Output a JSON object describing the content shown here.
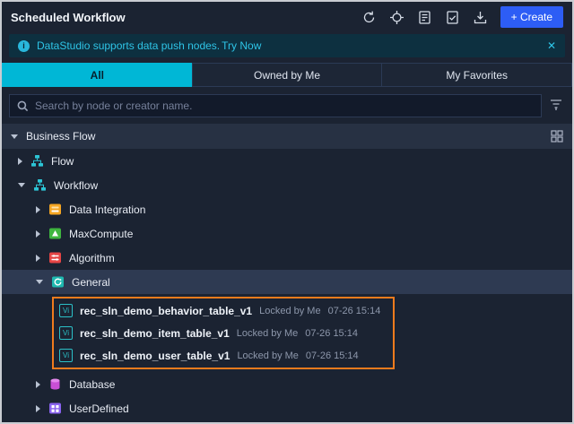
{
  "header": {
    "title": "Scheduled Workflow",
    "create_label": "+ Create"
  },
  "banner": {
    "message": "DataStudio supports data push nodes.",
    "link": "Try Now",
    "close": "✕"
  },
  "tabs": [
    {
      "label": "All",
      "active": true
    },
    {
      "label": "Owned by Me",
      "active": false
    },
    {
      "label": "My Favorites",
      "active": false
    }
  ],
  "search": {
    "placeholder": "Search by node or creator name."
  },
  "tree": {
    "root": {
      "label": "Business Flow"
    },
    "items": [
      {
        "label": "Flow"
      },
      {
        "label": "Workflow"
      },
      {
        "label": "Data Integration"
      },
      {
        "label": "MaxCompute"
      },
      {
        "label": "Algorithm"
      },
      {
        "label": "General"
      },
      {
        "label": "Database"
      },
      {
        "label": "UserDefined"
      }
    ],
    "nodes": [
      {
        "icon_label": "Vi",
        "name": "rec_sln_demo_behavior_table_v1",
        "status": "Locked by Me",
        "time": "07-26 15:14"
      },
      {
        "icon_label": "Vi",
        "name": "rec_sln_demo_item_table_v1",
        "status": "Locked by Me",
        "time": "07-26 15:14"
      },
      {
        "icon_label": "Vi",
        "name": "rec_sln_demo_user_table_v1",
        "status": "Locked by Me",
        "time": "07-26 15:14"
      }
    ]
  },
  "colors": {
    "accent_cyan": "#00b7d6",
    "create_blue": "#2d5df5",
    "highlight_orange": "#f07b1d",
    "banner_bg": "#0d3040"
  }
}
